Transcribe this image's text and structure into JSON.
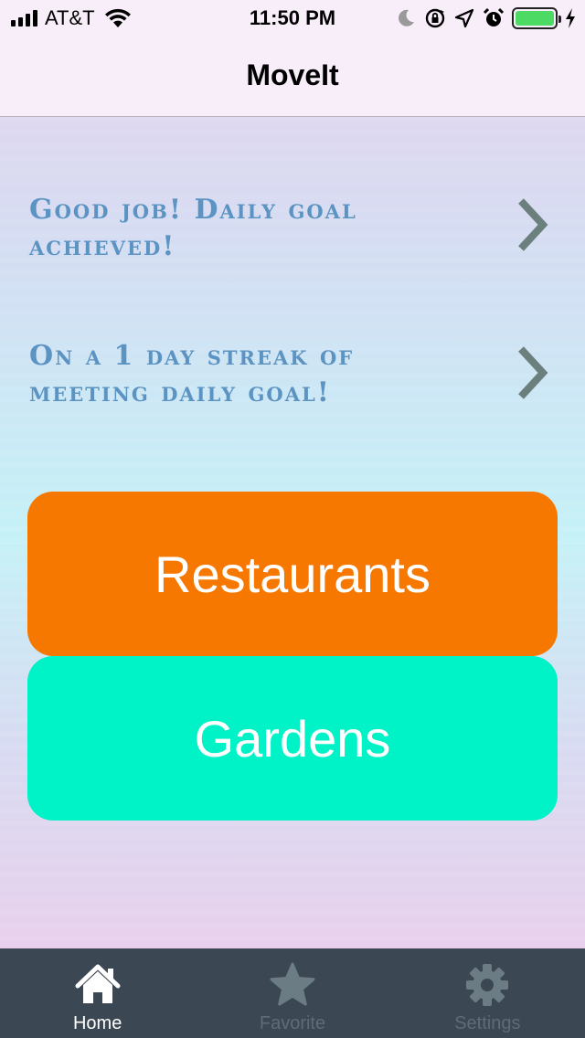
{
  "status_bar": {
    "carrier": "AT&T",
    "time": "11:50 PM",
    "battery_level": 1.0,
    "icons": [
      "signal-icon",
      "wifi-icon",
      "moon-icon",
      "rotation-lock-icon",
      "location-arrow-icon",
      "alarm-icon",
      "battery-icon",
      "charging-bolt-icon"
    ]
  },
  "nav": {
    "title": "MoveIt"
  },
  "messages": [
    {
      "text": "Good job! Daily goal achieved!",
      "icon": "chevron-right-icon"
    },
    {
      "text": "On a 1 day streak of meeting daily goal!",
      "icon": "chevron-right-icon"
    }
  ],
  "buttons": {
    "restaurants": {
      "label": "Restaurants",
      "color": "#f77800"
    },
    "gardens": {
      "label": "Gardens",
      "color": "#00f2c7"
    }
  },
  "tabs": [
    {
      "label": "Home",
      "icon": "home-icon",
      "active": true
    },
    {
      "label": "Favorite",
      "icon": "star-icon",
      "active": false
    },
    {
      "label": "Settings",
      "icon": "gear-icon",
      "active": false
    }
  ],
  "colors": {
    "message_text": "#5b93c3",
    "chevron": "#6b7f7d",
    "tab_bar": "#3b4753",
    "tab_inactive": "#6b7c85",
    "battery_fill": "#4cd964"
  }
}
